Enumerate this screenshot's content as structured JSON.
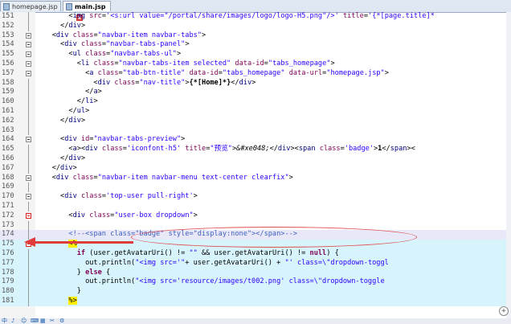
{
  "tabs": [
    {
      "label": "homepage.jsp",
      "active": false
    },
    {
      "label": "main.jsp",
      "active": true
    }
  ],
  "close_glyph": "x",
  "lines": [
    {
      "num": "151",
      "html": "        &lt;<span class='t'>img</span> <span class='a'>src</span>=<span class='s'>'&lt;s:url value=\"/portal/share/images/logo/logo-H5.png\"/&gt;'</span> <span class='a'>title</span>=<span class='s'>'{*[page.title]*</span>"
    },
    {
      "num": "152",
      "html": "      &lt;/<span class='t'>div</span>&gt;"
    },
    {
      "num": "153",
      "html": "    &lt;<span class='t'>div</span> <span class='a'>class</span>=<span class='s'>\"navbar-item navbar-tabs\"</span>&gt;"
    },
    {
      "num": "154",
      "html": "      &lt;<span class='t'>div</span> <span class='a'>class</span>=<span class='s'>\"navbar-tabs-panel\"</span>&gt;"
    },
    {
      "num": "155",
      "html": "        &lt;<span class='t'>ul</span> <span class='a'>class</span>=<span class='s'>\"navbar-tabs-ul\"</span>&gt;"
    },
    {
      "num": "156",
      "html": "          &lt;<span class='t'>li</span> <span class='a'>class</span>=<span class='s'>\"navbar-tabs-item selected\"</span> <span class='a'>data-id</span>=<span class='s'>\"tabs_homepage\"</span>&gt;"
    },
    {
      "num": "157",
      "html": "            &lt;<span class='t'>a</span> <span class='a'>class</span>=<span class='s'>\"tab-btn-title\"</span> <span class='a'>data-id</span>=<span class='s'>\"tabs_homepage\"</span> <span class='a'>data-url</span>=<span class='s'>\"homepage.jsp\"</span>&gt;"
    },
    {
      "num": "158",
      "html": "              &lt;<span class='t'>div</span> <span class='a'>class</span>=<span class='s'>\"nav-title\"</span>&gt;<b>{*[Home]*}</b>&lt;/<span class='t'>div</span>&gt;"
    },
    {
      "num": "159",
      "html": "            &lt;/<span class='t'>a</span>&gt;"
    },
    {
      "num": "160",
      "html": "          &lt;/<span class='t'>li</span>&gt;"
    },
    {
      "num": "161",
      "html": "        &lt;/<span class='t'>ul</span>&gt;"
    },
    {
      "num": "162",
      "html": "      &lt;/<span class='t'>div</span>&gt;"
    },
    {
      "num": "163",
      "html": ""
    },
    {
      "num": "164",
      "html": "      &lt;<span class='t'>div</span> <span class='a'>id</span>=<span class='s'>\"navbar-tabs-preview\"</span>&gt;"
    },
    {
      "num": "165",
      "html": "        &lt;<span class='t'>a</span>&gt;&lt;<span class='t'>div</span> <span class='a'>class</span>=<span class='s'>'iconfont-h5'</span> <span class='a'>title</span>=<span class='s'>\"预览\"</span>&gt;<i>&amp;#xe048;</i>&lt;/<span class='t'>div</span>&gt;&lt;<span class='t'>span</span> <span class='a'>class</span>=<span class='s'>'badge'</span>&gt;<b>1</b>&lt;/<span class='t'>span</span>&gt;&lt;"
    },
    {
      "num": "166",
      "html": "      &lt;/<span class='t'>div</span>&gt;"
    },
    {
      "num": "167",
      "html": "    &lt;/<span class='t'>div</span>&gt;"
    },
    {
      "num": "168",
      "html": "    &lt;<span class='t'>div</span> <span class='a'>class</span>=<span class='s'>\"navbar-item navbar-menu text-center clearfix\"</span>&gt;"
    },
    {
      "num": "169",
      "html": ""
    },
    {
      "num": "170",
      "html": "      &lt;<span class='t'>div</span> <span class='a'>class</span>=<span class='s'>'top-user pull-right'</span>&gt;"
    },
    {
      "num": "171",
      "html": ""
    },
    {
      "num": "172",
      "html": "        &lt;<span class='t'>div</span> <span class='a'>class</span>=<span class='s'>\"user-box dropdown\"</span>&gt;"
    },
    {
      "num": "173",
      "html": ""
    },
    {
      "num": "174",
      "html": "        <span class='c'>&lt;!--&lt;span class=\"badge\" style=\"display:none\"&gt;&lt;/span&gt;--&gt;</span>"
    },
    {
      "num": "175",
      "html": "        <span class='scriptlet'>&lt;%</span>"
    },
    {
      "num": "176",
      "html": "          <span class='k'>if</span> (user.getAvatarUri() != <span class='s'>\"\"</span> &amp;&amp; user.getAvatarUri() != <span class='k'>null</span>) {"
    },
    {
      "num": "177",
      "html": "            out.println(<span class='s'>\"&lt;img src='\"</span>+ user.getAvatarUri() + <span class='s'>\"' class=\\\"dropdown-toggl</span>"
    },
    {
      "num": "178",
      "html": "          } <span class='k'>else</span> {"
    },
    {
      "num": "179",
      "html": "            out.println(<span class='s'>\"&lt;img src='resource/images/t002.png' class=\\\"dropdown-toggle</span>"
    },
    {
      "num": "180",
      "html": "          }"
    },
    {
      "num": "181",
      "html": "        <span class='scriptlet'>%&gt;</span>"
    }
  ],
  "colors": {
    "tag": "#000080",
    "attr": "#7f0055",
    "value": "#2a00ff",
    "comment": "#3f5fbf",
    "highlight": "#d7f3fb",
    "annotation": "#e03c3c"
  },
  "status_icons": [
    "中",
    "♪",
    "☺",
    "⌨",
    "▦",
    "✂",
    "⚙"
  ]
}
